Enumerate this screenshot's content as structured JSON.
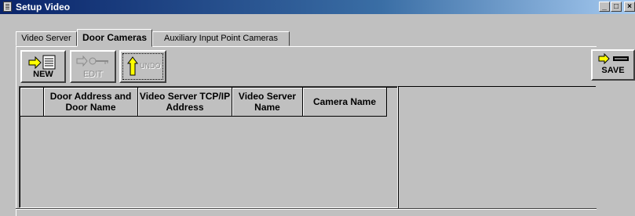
{
  "window": {
    "title": "Setup Video",
    "minimize_glyph": "_",
    "maximize_glyph": "□",
    "close_glyph": "×"
  },
  "tabs": [
    {
      "label": "Video Server",
      "active": false
    },
    {
      "label": "Door Cameras",
      "active": true
    },
    {
      "label": "Auxiliary Input Point Cameras",
      "active": false
    }
  ],
  "toolbar": {
    "new_label": "NEW",
    "edit_label": "EDIT",
    "undo_label": "UNDO",
    "save_label": "SAVE"
  },
  "grid": {
    "columns": [
      "",
      "Door Address and Door Name",
      "Video Server TCP/IP Address",
      "Video Server Name",
      "Camera Name"
    ],
    "rows": []
  },
  "icons": {
    "app": "window-icon",
    "new": "arrow-notepad-icon",
    "edit": "arrow-key-icon",
    "undo": "up-arrow-icon",
    "save": "arrow-disk-icon"
  },
  "colors": {
    "titlebar_start": "#0a246a",
    "titlebar_end": "#a6caf0",
    "face": "#c0c0c0",
    "arrow": "#ffff00"
  }
}
